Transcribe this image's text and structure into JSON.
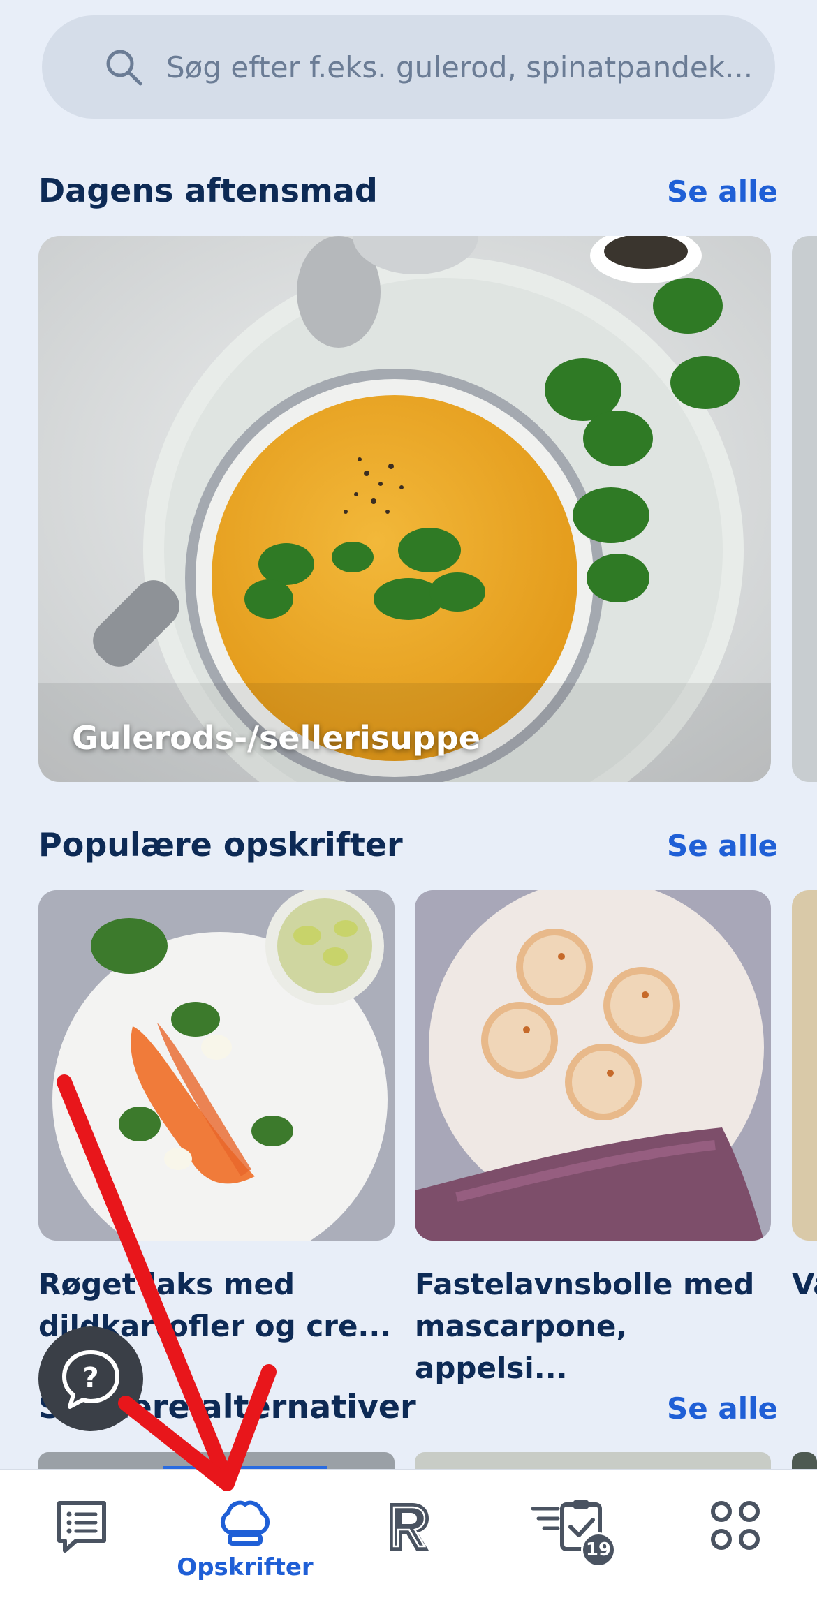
{
  "search": {
    "placeholder": "Søg efter f.eks. gulerod, spinatpandek..."
  },
  "sections": {
    "dinner": {
      "title": "Dagens aftensmad",
      "see_all": "Se alle",
      "featured": "Gulerods-/sellerisuppe"
    },
    "popular": {
      "title": "Populære opskrifter",
      "see_all": "Se alle",
      "cards": [
        {
          "line1": "Røget laks med",
          "line2": "dildkartofler og cre..."
        },
        {
          "line1": "Fastelavnsbolle med",
          "line2": "mascarpone, appelsi..."
        },
        {
          "line1": "Va"
        }
      ]
    },
    "alternatives": {
      "title": "Sundere alternativer",
      "see_all": "Se alle"
    }
  },
  "tabbar": {
    "tabs": [
      {
        "name": "list",
        "icon": "list-icon"
      },
      {
        "name": "recipes",
        "icon": "chef-hat-icon",
        "label": "Opskrifter",
        "active": true
      },
      {
        "name": "rema",
        "icon": "r-logo-icon"
      },
      {
        "name": "tasks",
        "icon": "checklist-icon",
        "badge": "19"
      },
      {
        "name": "more",
        "icon": "grid-icon"
      }
    ]
  },
  "colors": {
    "accent": "#1f5fd6",
    "title": "#0d2a55",
    "background": "#e8eef8",
    "annotation": "#e8161b"
  }
}
